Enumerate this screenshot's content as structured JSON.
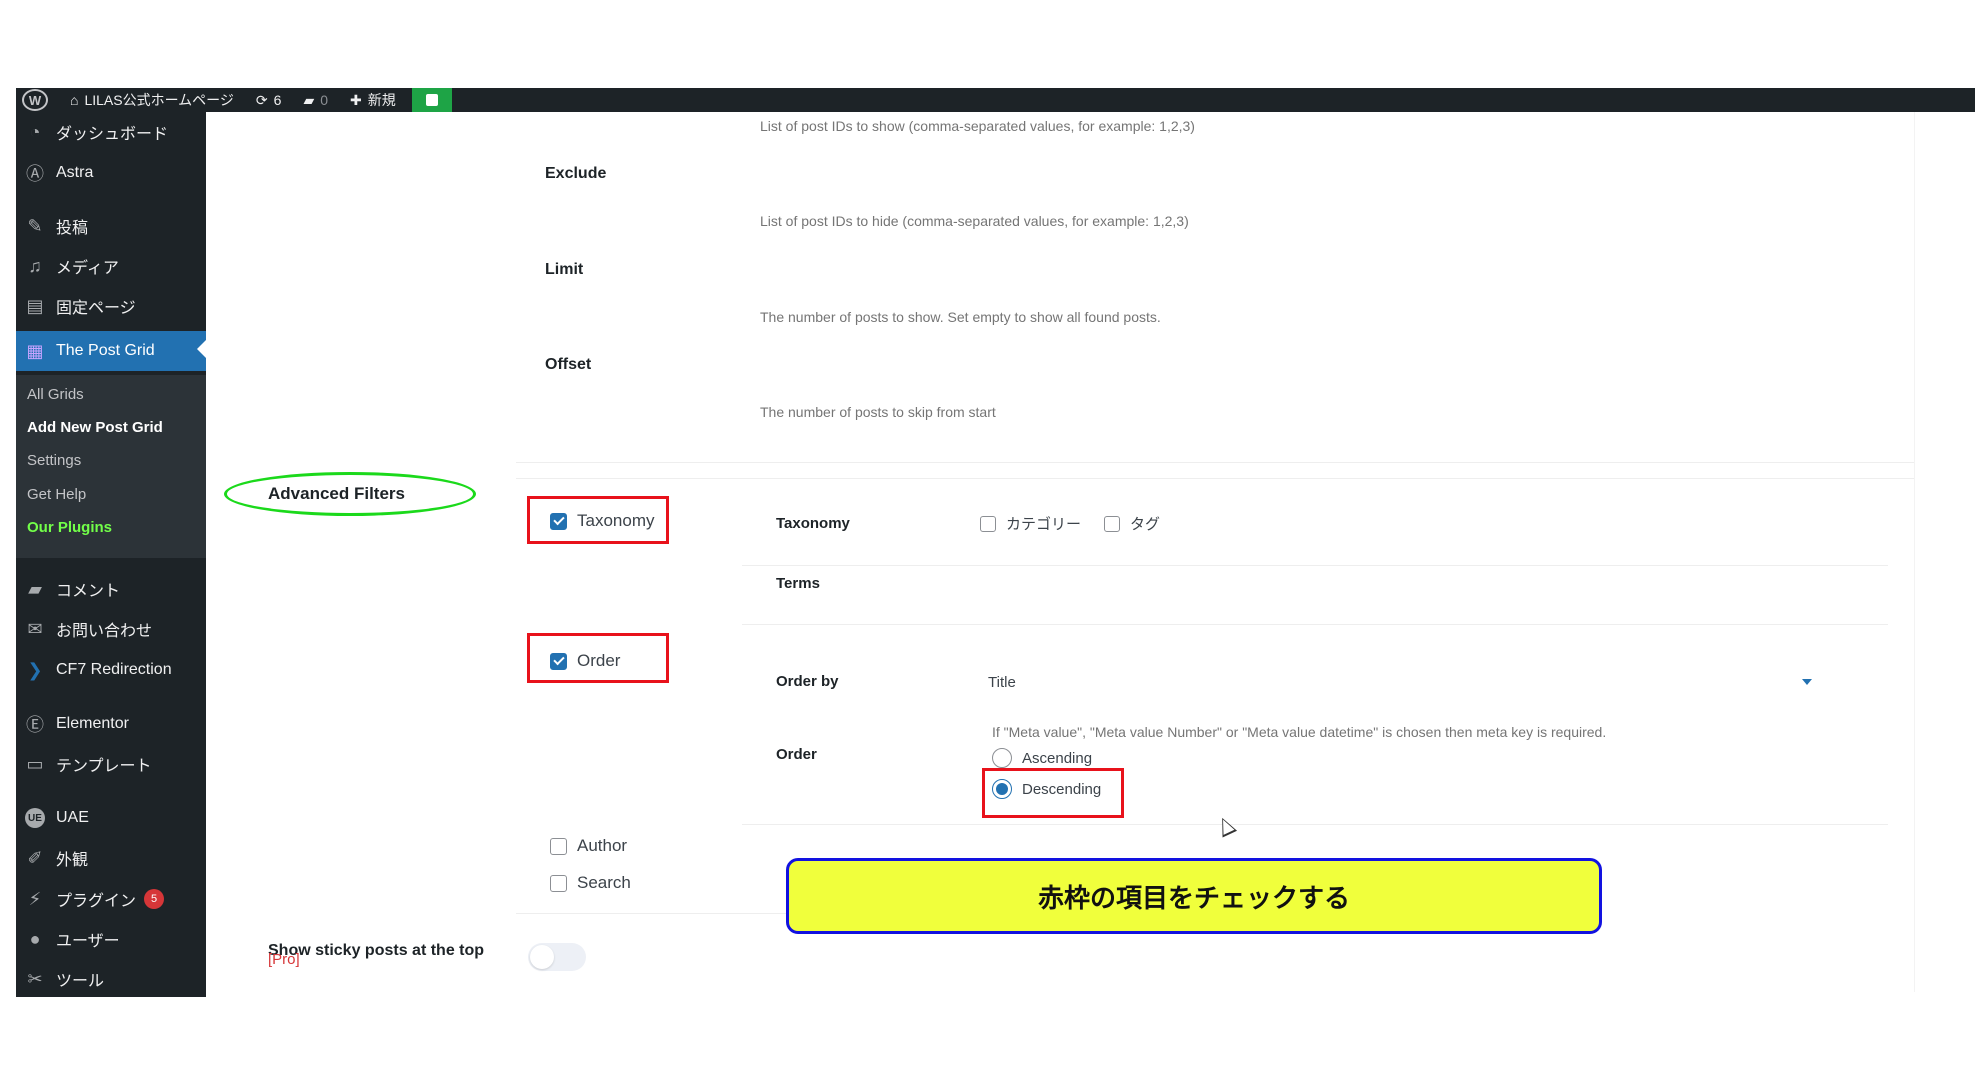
{
  "adminbar": {
    "site_name": "LILAS公式ホームページ",
    "updates_count": "6",
    "comments_count": "0",
    "new_label": "新規"
  },
  "sidebar": {
    "items": [
      {
        "label": "ダッシュボード",
        "icon": "dashboard-icon"
      },
      {
        "label": "Astra",
        "icon": "astra-icon"
      },
      {
        "label": "投稿",
        "icon": "pin-icon"
      },
      {
        "label": "メディア",
        "icon": "media-icon"
      },
      {
        "label": "固定ページ",
        "icon": "page-icon"
      },
      {
        "label": "The Post Grid",
        "icon": "grid-icon"
      },
      {
        "label": "コメント",
        "icon": "comment-icon"
      },
      {
        "label": "お問い合わせ",
        "icon": "mail-icon"
      },
      {
        "label": "CF7 Redirection",
        "icon": "chevron-right-icon"
      },
      {
        "label": "Elementor",
        "icon": "elementor-icon"
      },
      {
        "label": "テンプレート",
        "icon": "folder-icon"
      },
      {
        "label": "UAE",
        "icon": "uae-icon"
      },
      {
        "label": "外観",
        "icon": "brush-icon"
      },
      {
        "label": "プラグイン",
        "icon": "plugin-icon",
        "badge": "5"
      },
      {
        "label": "ユーザー",
        "icon": "user-icon"
      },
      {
        "label": "ツール",
        "icon": "wrench-icon"
      }
    ],
    "submenu": [
      "All Grids",
      "Add New Post Grid",
      "Settings",
      "Get Help",
      "Our Plugins"
    ]
  },
  "fields": {
    "include_desc": "List of post IDs to show (comma-separated values, for example: 1,2,3)",
    "exclude_label": "Exclude",
    "exclude_desc": "List of post IDs to hide (comma-separated values, for example: 1,2,3)",
    "limit_label": "Limit",
    "limit_desc": "The number of posts to show. Set empty to show all found posts.",
    "offset_label": "Offset",
    "offset_desc": "The number of posts to skip from start"
  },
  "advanced_filters": {
    "title": "Advanced Filters",
    "options": [
      {
        "label": "Taxonomy",
        "checked": true
      },
      {
        "label": "Order",
        "checked": true
      },
      {
        "label": "Author",
        "checked": false
      },
      {
        "label": "Search",
        "checked": false
      }
    ],
    "taxonomy_label": "Taxonomy",
    "taxonomy_options": [
      "カテゴリー",
      "タグ"
    ],
    "terms_label": "Terms",
    "order_by_label": "Order by",
    "order_by_value": "Title",
    "order_label": "Order",
    "order_note": "If \"Meta value\", \"Meta value Number\" or \"Meta value datetime\" is chosen then meta key is required.",
    "order_options": [
      {
        "label": "Ascending",
        "selected": false
      },
      {
        "label": "Descending",
        "selected": true
      }
    ]
  },
  "sticky": {
    "label": "Show sticky posts at the top",
    "pro": "[Pro]",
    "enabled": false
  },
  "callout": {
    "text": "赤枠の項目をチェックする",
    "bg_color": "#f0ff3c",
    "border_color": "#1212e0"
  },
  "colors": {
    "admin_dark": "#1d2327",
    "accent": "#2271b1",
    "highlight_red": "#e8121b",
    "ellipse_green": "#1bd91b"
  }
}
